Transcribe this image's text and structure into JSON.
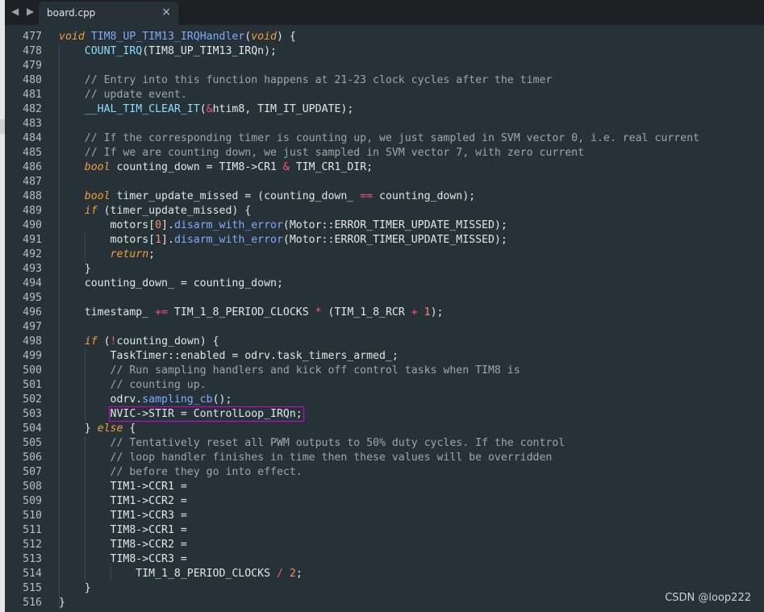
{
  "tab": {
    "filename": "board.cpp",
    "close_glyph": "×",
    "nav_glyph": "◀ ▶"
  },
  "watermark": "CSDN @loop222",
  "colors": {
    "editor_bg": "#263238",
    "tabbar_bg": "#1d2124",
    "highlight_box": "#d400d4",
    "keyword": "#f0a03c",
    "function": "#82aaff",
    "comment": "#9aa7ae"
  },
  "highlight_line": 503,
  "lines": [
    {
      "n": "477",
      "t": "void TIM8_UP_TIM13_IRQHandler(void) {"
    },
    {
      "n": "478",
      "t": "    COUNT_IRQ(TIM8_UP_TIM13_IRQn);"
    },
    {
      "n": "479",
      "t": ""
    },
    {
      "n": "480",
      "t": "    // Entry into this function happens at 21-23 clock cycles after the timer"
    },
    {
      "n": "481",
      "t": "    // update event."
    },
    {
      "n": "482",
      "t": "    __HAL_TIM_CLEAR_IT(&htim8, TIM_IT_UPDATE);"
    },
    {
      "n": "483",
      "t": ""
    },
    {
      "n": "484",
      "t": "    // If the corresponding timer is counting up, we just sampled in SVM vector 0, i.e. real current"
    },
    {
      "n": "485",
      "t": "    // If we are counting down, we just sampled in SVM vector 7, with zero current"
    },
    {
      "n": "486",
      "t": "    bool counting_down = TIM8->CR1 & TIM_CR1_DIR;"
    },
    {
      "n": "487",
      "t": ""
    },
    {
      "n": "488",
      "t": "    bool timer_update_missed = (counting_down_ == counting_down);"
    },
    {
      "n": "489",
      "t": "    if (timer_update_missed) {"
    },
    {
      "n": "490",
      "t": "        motors[0].disarm_with_error(Motor::ERROR_TIMER_UPDATE_MISSED);"
    },
    {
      "n": "491",
      "t": "        motors[1].disarm_with_error(Motor::ERROR_TIMER_UPDATE_MISSED);"
    },
    {
      "n": "492",
      "t": "        return;"
    },
    {
      "n": "493",
      "t": "    }"
    },
    {
      "n": "494",
      "t": "    counting_down_ = counting_down;"
    },
    {
      "n": "495",
      "t": ""
    },
    {
      "n": "496",
      "t": "    timestamp_ += TIM_1_8_PERIOD_CLOCKS * (TIM_1_8_RCR + 1);"
    },
    {
      "n": "497",
      "t": ""
    },
    {
      "n": "498",
      "t": "    if (!counting_down) {"
    },
    {
      "n": "499",
      "t": "        TaskTimer::enabled = odrv.task_timers_armed_;"
    },
    {
      "n": "500",
      "t": "        // Run sampling handlers and kick off control tasks when TIM8 is"
    },
    {
      "n": "501",
      "t": "        // counting up."
    },
    {
      "n": "502",
      "t": "        odrv.sampling_cb();"
    },
    {
      "n": "503",
      "t": "        NVIC->STIR = ControlLoop_IRQn;"
    },
    {
      "n": "504",
      "t": "    } else {"
    },
    {
      "n": "505",
      "t": "        // Tentatively reset all PWM outputs to 50% duty cycles. If the control"
    },
    {
      "n": "506",
      "t": "        // loop handler finishes in time then these values will be overridden"
    },
    {
      "n": "507",
      "t": "        // before they go into effect."
    },
    {
      "n": "508",
      "t": "        TIM1->CCR1 ="
    },
    {
      "n": "509",
      "t": "        TIM1->CCR2 ="
    },
    {
      "n": "510",
      "t": "        TIM1->CCR3 ="
    },
    {
      "n": "511",
      "t": "        TIM8->CCR1 ="
    },
    {
      "n": "512",
      "t": "        TIM8->CCR2 ="
    },
    {
      "n": "513",
      "t": "        TIM8->CCR3 ="
    },
    {
      "n": "514",
      "t": "            TIM_1_8_PERIOD_CLOCKS / 2;"
    },
    {
      "n": "515",
      "t": "    }"
    },
    {
      "n": "516",
      "t": "}"
    }
  ]
}
